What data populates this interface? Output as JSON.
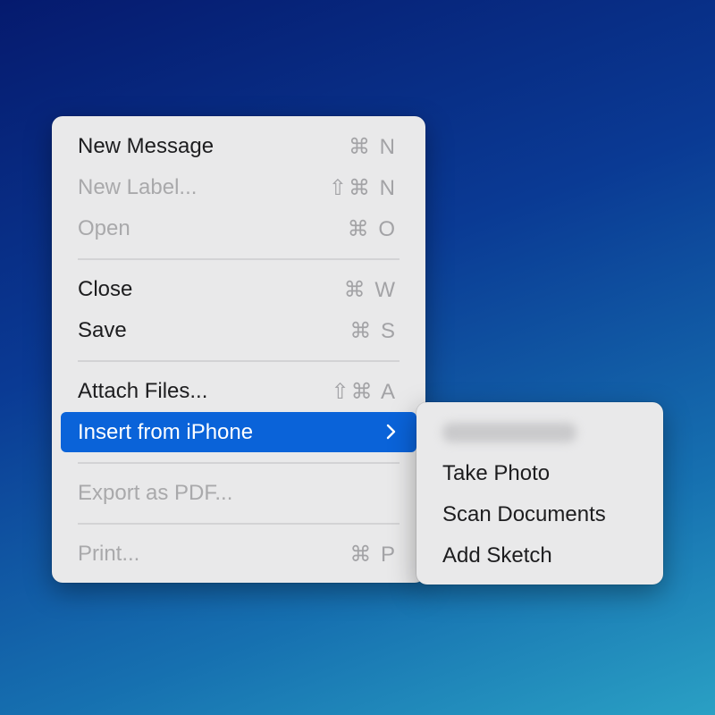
{
  "menu": {
    "items": [
      {
        "label": "New Message",
        "shortcut": "⌘ N",
        "enabled": true
      },
      {
        "label": "New Label...",
        "shortcut": "⇧⌘ N",
        "enabled": false
      },
      {
        "label": "Open",
        "shortcut": "⌘ O",
        "enabled": false
      },
      {
        "label": "Close",
        "shortcut": "⌘ W",
        "enabled": true
      },
      {
        "label": "Save",
        "shortcut": "⌘ S",
        "enabled": true
      },
      {
        "label": "Attach Files...",
        "shortcut": "⇧⌘ A",
        "enabled": true
      },
      {
        "label": "Insert from iPhone",
        "submenu_icon": "chevron-right-icon",
        "highlighted": true
      },
      {
        "label": "Export as PDF...",
        "enabled": false
      },
      {
        "label": "Print...",
        "shortcut": "⌘ P",
        "enabled": false
      }
    ]
  },
  "submenu": {
    "items": [
      {
        "label": "Take Photo"
      },
      {
        "label": "Scan Documents"
      },
      {
        "label": "Add Sketch"
      }
    ]
  },
  "colors": {
    "highlight": "#0a63d9",
    "menu_bg": "#e9e9ea",
    "disabled_text": "#a9a9ab"
  }
}
